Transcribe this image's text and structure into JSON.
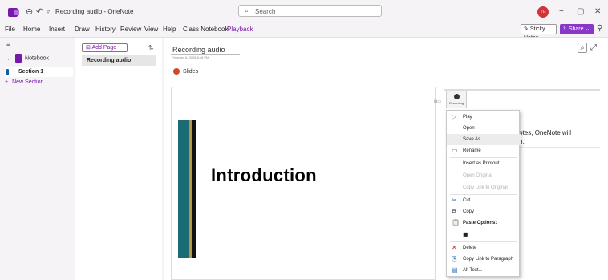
{
  "window": {
    "title": "Recording audio - OneNote",
    "search_placeholder": "Search",
    "avatar": "TG",
    "controls": [
      "−",
      "▢",
      "✕"
    ]
  },
  "menu": {
    "items": [
      "File",
      "Home",
      "Insert",
      "Draw",
      "History",
      "Review",
      "View",
      "Help",
      "Class Notebook",
      "Playback"
    ],
    "active": "Playback",
    "sticky_notes": "Sticky Notes",
    "share": "Share"
  },
  "nav": {
    "notebook": "Notebook",
    "section": "Section 1",
    "new_section": "New Section"
  },
  "pages": {
    "add_page": "Add Page",
    "page": "Recording audio"
  },
  "canvas": {
    "page_title": "Recording audio",
    "page_date": "February 6, 2026      5:48 PM",
    "slides_label": "Slides",
    "slide_title": "Introduction",
    "audio_label": "Recording",
    "note_text_1": "e notes, OneNote will",
    "note_text_2": "hem."
  },
  "context_menu": {
    "items": [
      {
        "label": "Play",
        "icon": "play-icon"
      },
      {
        "label": "Open",
        "icon": ""
      },
      {
        "label": "Save As...",
        "icon": ""
      },
      {
        "label": "Rename",
        "icon": "rename-icon"
      },
      {
        "label": "Insert as Printout",
        "icon": ""
      },
      {
        "label": "Open Original",
        "icon": ""
      },
      {
        "label": "Copy Link to Original",
        "icon": ""
      },
      {
        "label": "Cut",
        "icon": "scissors-icon"
      },
      {
        "label": "Copy",
        "icon": "copy-icon"
      },
      {
        "label": "Paste Options:",
        "icon": "paste-icon"
      },
      {
        "label": "Delete",
        "icon": "delete-icon"
      },
      {
        "label": "Copy Link to Paragraph",
        "icon": "link-icon"
      },
      {
        "label": "Alt Text...",
        "icon": "alt-text-icon"
      }
    ]
  },
  "colors": {
    "brand": "#7719aa",
    "share": "#8a36c8",
    "slide_stripe_teal": "#1a6b73",
    "slide_stripe_gold": "#b8944a"
  }
}
